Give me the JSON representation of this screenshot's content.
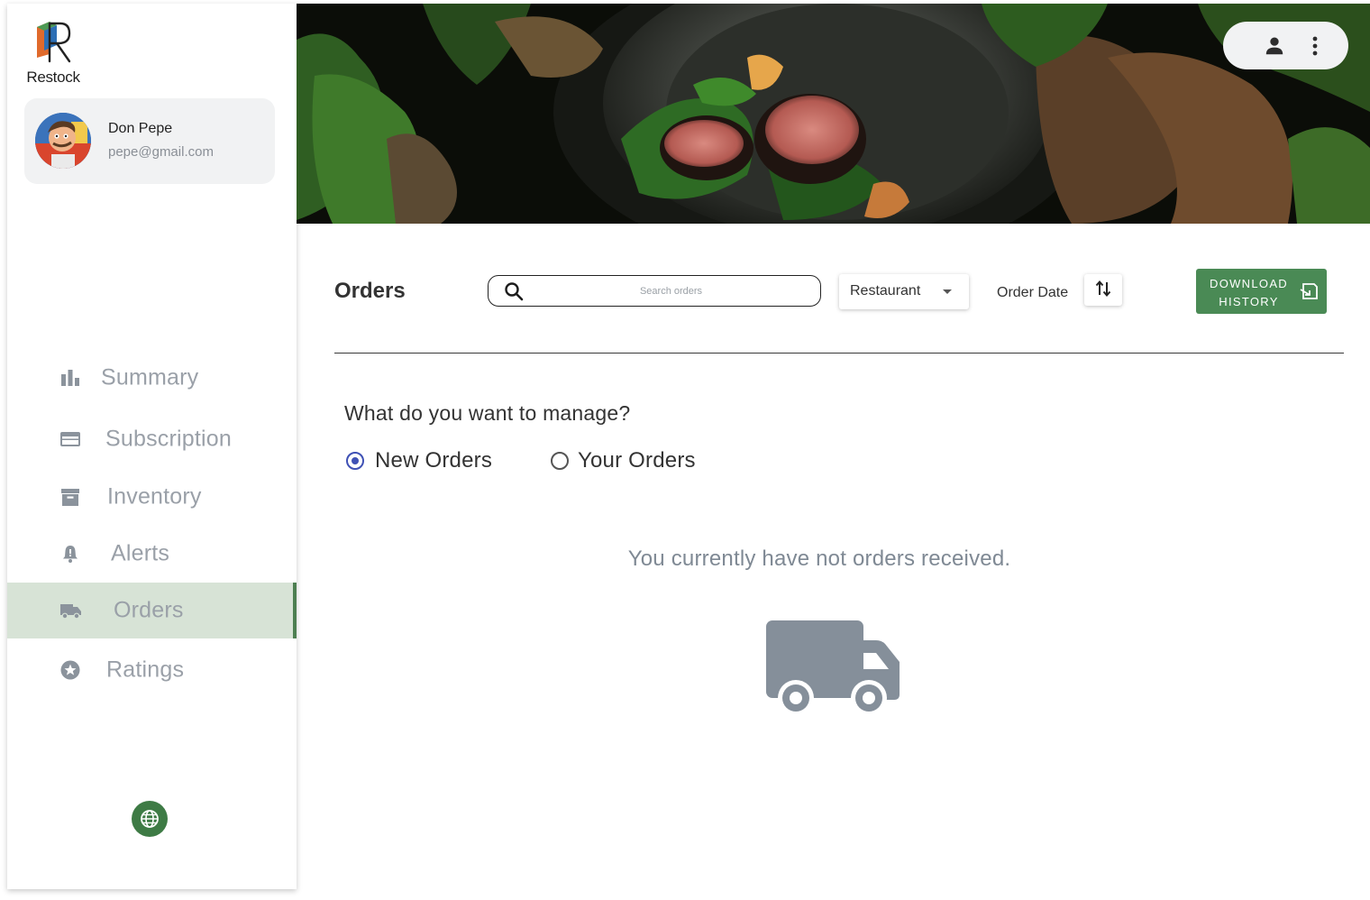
{
  "brand": {
    "name": "Restock"
  },
  "user": {
    "name": "Don Pepe",
    "email": "pepe@gmail.com"
  },
  "nav": {
    "items": [
      {
        "label": "Summary",
        "icon": "bar-chart-icon",
        "active": false
      },
      {
        "label": "Subscription",
        "icon": "credit-card-icon",
        "active": false
      },
      {
        "label": "Inventory",
        "icon": "archive-box-icon",
        "active": false
      },
      {
        "label": "Alerts",
        "icon": "bell-alert-icon",
        "active": false
      },
      {
        "label": "Orders",
        "icon": "truck-icon",
        "active": true
      },
      {
        "label": "Ratings",
        "icon": "star-circle-icon",
        "active": false
      }
    ]
  },
  "footer": {
    "language_icon": "globe-icon"
  },
  "header": {
    "user_icon": "person-icon",
    "menu_icon": "more-vert-icon"
  },
  "orders": {
    "title": "Orders",
    "search_placeholder": "Search orders",
    "filter_value": "Restaurant",
    "sort_label": "Order Date",
    "download_label_line1": "DOWNLOAD",
    "download_label_line2": "HISTORY"
  },
  "manage": {
    "question": "What do you want to manage?",
    "options": [
      {
        "label": "New Orders",
        "selected": true
      },
      {
        "label": "Your Orders",
        "selected": false
      }
    ]
  },
  "empty_state": {
    "message": "You currently have not orders received."
  },
  "colors": {
    "accent_green": "#4a8a55",
    "active_nav_bg": "#d7e3d6",
    "radio_blue": "#3f51b5",
    "muted_text": "#7f8994"
  }
}
